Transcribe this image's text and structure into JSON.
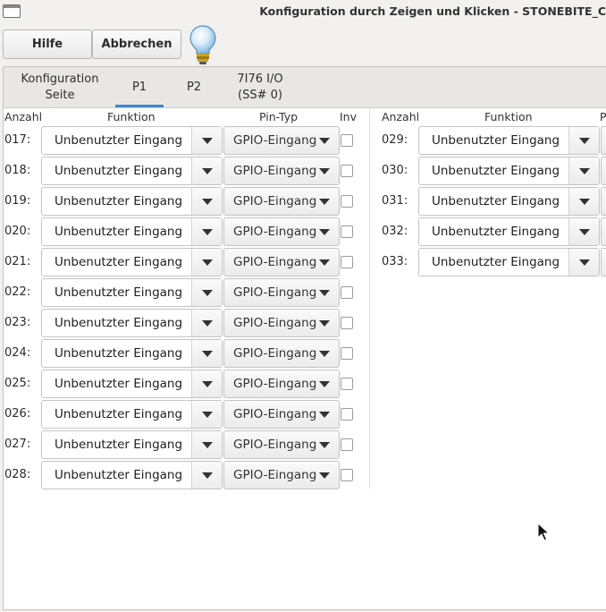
{
  "window": {
    "title": "Konfiguration durch Zeigen und Klicken - STONEBITE_C"
  },
  "toolbar": {
    "help_label": "Hilfe",
    "cancel_label": "Abbrechen"
  },
  "tabs": [
    {
      "label": "Konfiguration\nSeite",
      "active": false
    },
    {
      "label": "P1",
      "active": true
    },
    {
      "label": "P2",
      "active": false
    },
    {
      "label": "7I76 I/O\n(SS# 0)",
      "active": false
    }
  ],
  "headers": {
    "count": "Anzahl",
    "function": "Funktion",
    "pintype": "Pin-Typ",
    "inv": "Inv",
    "pintype_cut": "P"
  },
  "left_rows": [
    {
      "num": "017:",
      "function": "Unbenutzter Eingang",
      "pintype": "GPIO-Eingang"
    },
    {
      "num": "018:",
      "function": "Unbenutzter Eingang",
      "pintype": "GPIO-Eingang"
    },
    {
      "num": "019:",
      "function": "Unbenutzter Eingang",
      "pintype": "GPIO-Eingang"
    },
    {
      "num": "020:",
      "function": "Unbenutzter Eingang",
      "pintype": "GPIO-Eingang"
    },
    {
      "num": "021:",
      "function": "Unbenutzter Eingang",
      "pintype": "GPIO-Eingang"
    },
    {
      "num": "022:",
      "function": "Unbenutzter Eingang",
      "pintype": "GPIO-Eingang"
    },
    {
      "num": "023:",
      "function": "Unbenutzter Eingang",
      "pintype": "GPIO-Eingang"
    },
    {
      "num": "024:",
      "function": "Unbenutzter Eingang",
      "pintype": "GPIO-Eingang"
    },
    {
      "num": "025:",
      "function": "Unbenutzter Eingang",
      "pintype": "GPIO-Eingang"
    },
    {
      "num": "026:",
      "function": "Unbenutzter Eingang",
      "pintype": "GPIO-Eingang"
    },
    {
      "num": "027:",
      "function": "Unbenutzter Eingang",
      "pintype": "GPIO-Eingang"
    },
    {
      "num": "028:",
      "function": "Unbenutzter Eingang",
      "pintype": "GPIO-Eingang"
    }
  ],
  "right_rows": [
    {
      "num": "029:",
      "function": "Unbenutzter Eingang"
    },
    {
      "num": "030:",
      "function": "Unbenutzter Eingang"
    },
    {
      "num": "031:",
      "function": "Unbenutzter Eingang"
    },
    {
      "num": "032:",
      "function": "Unbenutzter Eingang"
    },
    {
      "num": "033:",
      "function": "Unbenutzter Eingang"
    }
  ]
}
